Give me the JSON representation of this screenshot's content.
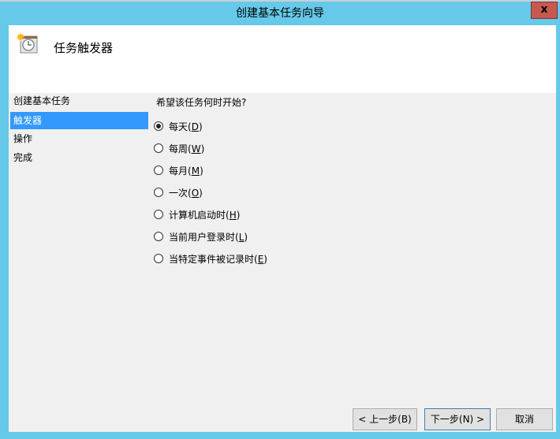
{
  "window": {
    "title": "创建基本任务向导",
    "close_label": "x"
  },
  "header": {
    "title": "任务触发器",
    "icon": "task-scheduler-clock-icon"
  },
  "nav": {
    "items": [
      {
        "label": "创建基本任务",
        "selected": false
      },
      {
        "label": "触发器",
        "selected": true
      },
      {
        "label": "操作",
        "selected": false
      },
      {
        "label": "完成",
        "selected": false
      }
    ]
  },
  "main": {
    "question": "希望该任务何时开始?",
    "options": [
      {
        "label": "每天",
        "key": "D",
        "checked": true
      },
      {
        "label": "每周",
        "key": "W",
        "checked": false
      },
      {
        "label": "每月",
        "key": "M",
        "checked": false
      },
      {
        "label": "一次",
        "key": "O",
        "checked": false
      },
      {
        "label": "计算机启动时",
        "key": "H",
        "checked": false
      },
      {
        "label": "当前用户登录时",
        "key": "L",
        "checked": false
      },
      {
        "label": "当特定事件被记录时",
        "key": "E",
        "checked": false
      }
    ]
  },
  "buttons": {
    "back": "< 上一步(B)",
    "next": "下一步(N) >",
    "cancel": "取消"
  },
  "colors": {
    "frame": "#66c9e9",
    "selection": "#3399ff",
    "close": "#c75850"
  }
}
